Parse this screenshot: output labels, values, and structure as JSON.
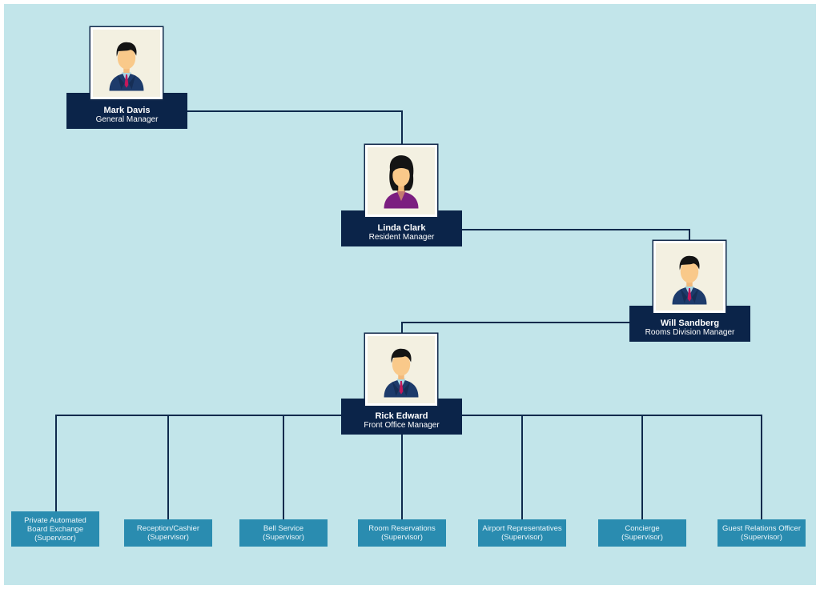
{
  "diagram": {
    "type": "org-chart",
    "colors": {
      "background": "#c2e5ea",
      "label_box": "#0b2449",
      "supervisor_box": "#2a8cb0",
      "connector": "#0f2a4d",
      "photo_bg": "#f3f0e1"
    },
    "people": [
      {
        "id": "mark",
        "name": "Mark Davis",
        "title": "General Manager",
        "avatar": "male-avatar-icon"
      },
      {
        "id": "linda",
        "name": "Linda Clark",
        "title": "Resident Manager",
        "avatar": "female-avatar-icon"
      },
      {
        "id": "will",
        "name": "Will Sandberg",
        "title": "Rooms Division Manager",
        "avatar": "male-avatar-icon"
      },
      {
        "id": "rick",
        "name": "Rick Edward",
        "title": "Front Office Manager",
        "avatar": "male-avatar-icon"
      }
    ],
    "supervisors": [
      {
        "line1": "Private Automated",
        "line2": "Board Exchange",
        "line3": "(Supervisor)"
      },
      {
        "line1": "Reception/Cashier",
        "line2": "(Supervisor)"
      },
      {
        "line1": "Bell Service",
        "line2": "(Supervisor)"
      },
      {
        "line1": "Room Reservations",
        "line2": "(Supervisor)"
      },
      {
        "line1": "Airport Representatives",
        "line2": "(Supervisor)"
      },
      {
        "line1": "Concierge",
        "line2": "(Supervisor)"
      },
      {
        "line1": "Guest Relations Officer",
        "line2": "(Supervisor)"
      }
    ],
    "reporting": [
      {
        "from": "Linda Clark",
        "to": "Mark Davis"
      },
      {
        "from": "Will Sandberg",
        "to": "Linda Clark"
      },
      {
        "from": "Rick Edward",
        "to": "Will Sandberg"
      },
      {
        "from": "Supervisors",
        "to": "Rick Edward"
      }
    ]
  }
}
